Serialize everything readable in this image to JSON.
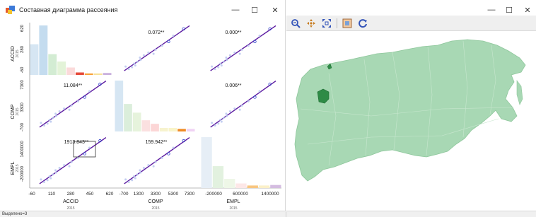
{
  "left_window": {
    "title": "Составная диаграмма рассеяния",
    "controls": {
      "minimize": "—",
      "maximize": "☐",
      "close": "✕"
    }
  },
  "right_window": {
    "controls": {
      "minimize": "—",
      "maximize": "☐",
      "close": "✕"
    },
    "toolbar_icons": [
      "zoom-icon",
      "pan-icon",
      "extent-icon",
      "select-icon",
      "refresh-icon"
    ]
  },
  "status": {
    "text": "Выделено=3"
  },
  "chart_data": {
    "type": "scatter",
    "variables": [
      "ACCID",
      "COMP",
      "EMPL"
    ],
    "year_label": "2015",
    "cell_labels": {
      "comp_vs_accid": "0.072**",
      "empl_vs_accid": "0.000**",
      "accid_vs_comp": "11.084**",
      "empl_vs_comp": "0.006**",
      "accid_vs_empl": "1913.843**",
      "comp_vs_empl": "159.942**"
    },
    "x_ticks": {
      "ACCID": [
        "-60",
        "110",
        "280",
        "450",
        "620"
      ],
      "COMP": [
        "-700",
        "1300",
        "3300",
        "5300",
        "7300"
      ],
      "EMPL": [
        "-200000",
        "600000",
        "1400000"
      ]
    },
    "y_ticks": {
      "ACCID": [
        "620",
        "280",
        "-60"
      ],
      "COMP": [
        "7300",
        "3300",
        "-700"
      ],
      "EMPL": [
        "1400000",
        "-200000"
      ]
    },
    "histograms": {
      "ACCID": [
        0.62,
        1.0,
        0.42,
        0.27,
        0.15,
        0.05,
        0.03,
        0.03,
        0.04
      ],
      "COMP": [
        1.0,
        0.54,
        0.37,
        0.22,
        0.15,
        0.07,
        0.07,
        0.05,
        0.05
      ],
      "EMPL": [
        1.0,
        0.43,
        0.18,
        0.09,
        0.05,
        0.05,
        0.06
      ]
    },
    "colors": {
      "point": "#b8c6ee",
      "point_selected": "#3344cc",
      "regression": "#5c1aa0",
      "map_fill": "#a8d8b4",
      "map_stroke": "#8fc79c",
      "map_selected": "#2e8b46"
    }
  }
}
